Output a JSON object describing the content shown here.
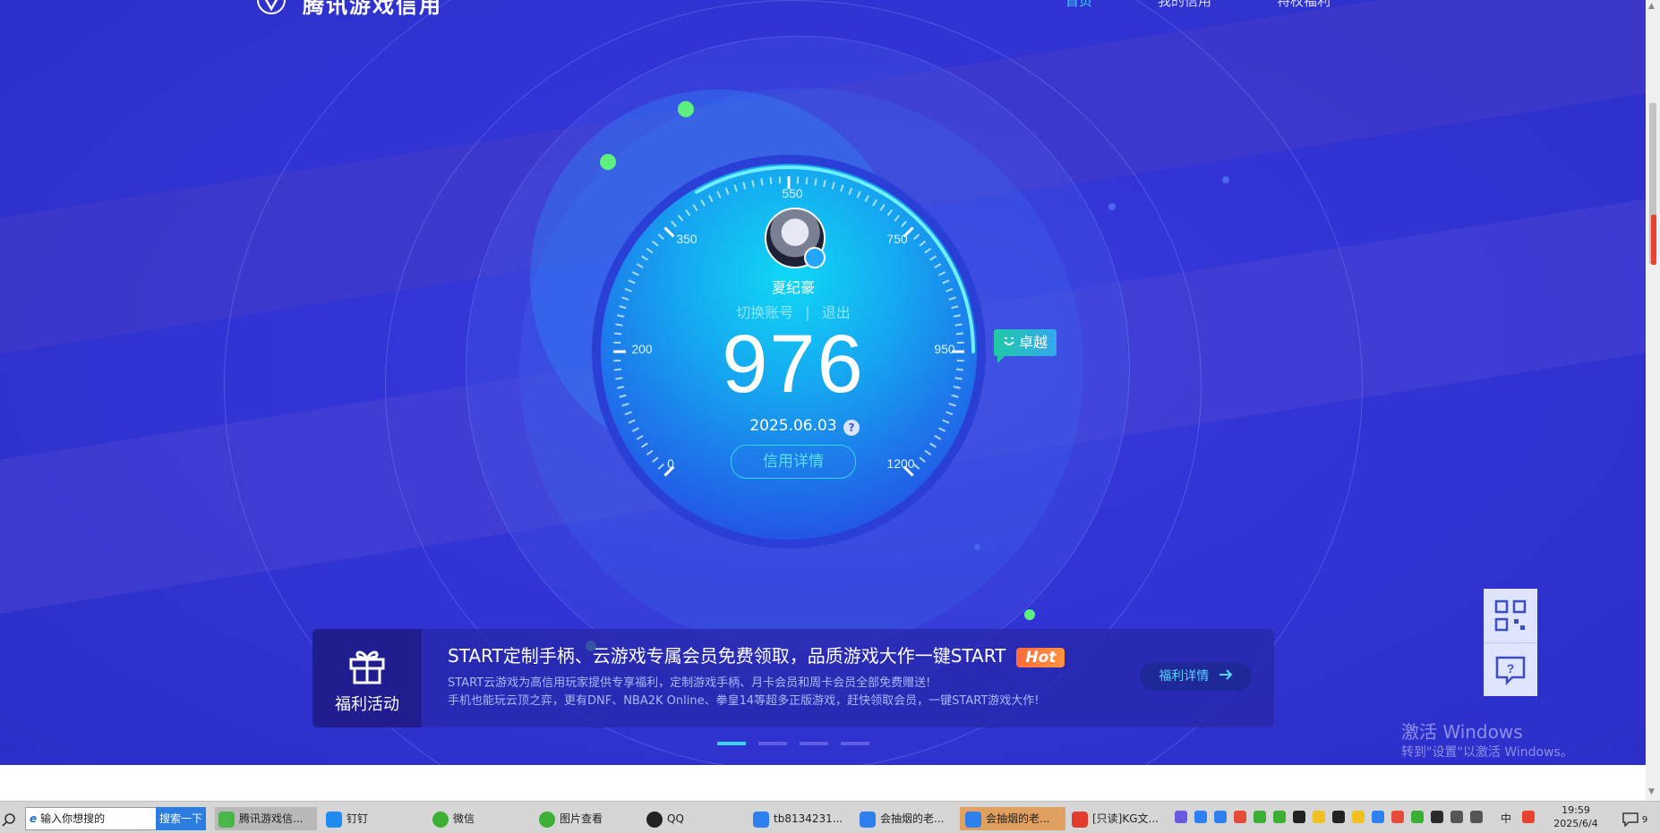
{
  "header": {
    "logo_text": "腾讯游戏信用",
    "nav": [
      "首页",
      "我的信用",
      "特权福利"
    ]
  },
  "gauge": {
    "ticks": [
      "0",
      "200",
      "350",
      "550",
      "750",
      "950",
      "1200"
    ],
    "username": "夏纪豪",
    "switch_account": "切换账号",
    "separator": "|",
    "logout": "退出",
    "score": "976",
    "date": "2025.06.03",
    "help": "?",
    "detail_button": "信用详情",
    "level": "卓越"
  },
  "banner": {
    "tag": "福利活动",
    "title": "START定制手柄、云游戏专属会员免费领取，品质游戏大作一键START",
    "hot": "Hot",
    "desc_line1": "START云游戏为高信用玩家提供专享福利，定制游戏手柄、月卡会员和周卡会员全部免费赠送!",
    "desc_line2": "手机也能玩云顶之弈，更有DNF、NBA2K Online、拳皇14等超多正版游戏，赶快领取会员，一键START游戏大作!",
    "button": "福利详情"
  },
  "watermark": {
    "line1": "激活 Windows",
    "line2": "转到\"设置\"以激活 Windows。"
  },
  "taskbar": {
    "search_placeholder": "输入你想搜的",
    "search_button": "搜索一下",
    "items": [
      "腾讯游戏信...",
      "钉钉",
      "微信",
      "图片查看",
      "QQ",
      "tb8134231...",
      "会抽烟的老...",
      "会抽烟的老...",
      "[只读]KG文..."
    ],
    "ime": "中",
    "time": "19:59",
    "date": "2025/6/4",
    "notification_count": "9"
  },
  "colors": {
    "background": "#3334d6",
    "accent": "#39d0ff",
    "level_tag": "#1fc9a6",
    "hot": "#ff6b3a"
  }
}
